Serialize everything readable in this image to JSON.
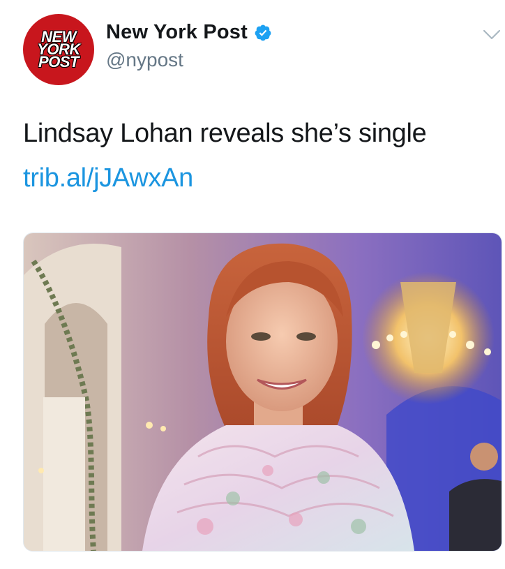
{
  "account": {
    "avatar_lines": [
      "NEW",
      "YORK",
      "POST"
    ],
    "display_name": "New York Post",
    "handle": "@nypost",
    "verified": true
  },
  "tweet": {
    "text": "Lindsay Lohan reveals she’s single",
    "link": "trib.al/jJAwxAn"
  },
  "icons": {
    "verified": "verified-badge-icon",
    "menu": "chevron-down-icon"
  },
  "colors": {
    "avatar_bg": "#c8161d",
    "verified": "#1da1f2",
    "link": "#1b95e0",
    "handle": "#657786",
    "text": "#14171a"
  }
}
